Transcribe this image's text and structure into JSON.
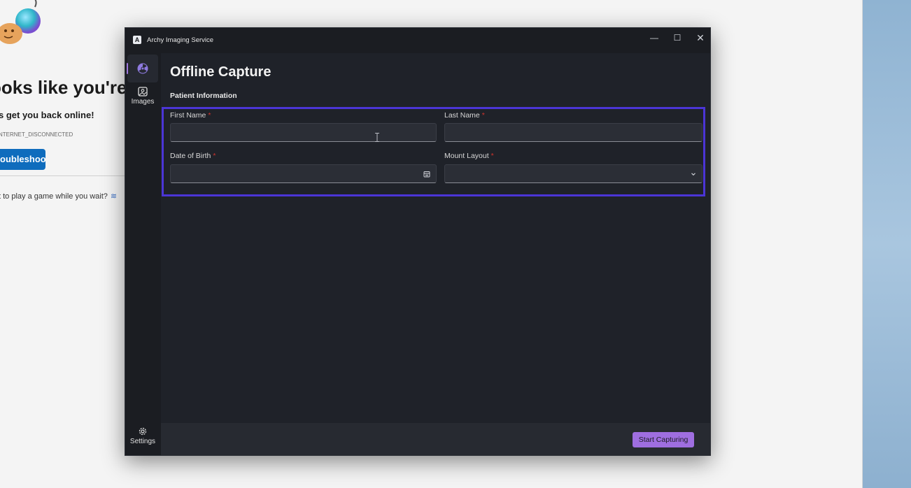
{
  "background_page": {
    "headline": "ooks like you're n",
    "subtitle": "s get you back online!",
    "error_code": "NTERNET_DISCONNECTED",
    "troubleshoot_label": "oubleshoot",
    "game_prompt": "t to play a game while you wait?",
    "game_wave": "≋"
  },
  "window": {
    "title": "Archy Imaging Service",
    "logo_letter": "A",
    "controls": {
      "minimize": "—",
      "maximize": "☐",
      "close": "✕"
    }
  },
  "sidebar": {
    "items": [
      {
        "label": "",
        "icon": "radiation-icon",
        "active": true
      },
      {
        "label": "Images",
        "icon": "image-icon"
      },
      {
        "label": "Settings",
        "icon": "gear-icon"
      }
    ]
  },
  "main": {
    "title": "Offline Capture",
    "section": "Patient Information",
    "fields": {
      "first_name": {
        "label": "First Name",
        "required": "*",
        "value": ""
      },
      "last_name": {
        "label": "Last Name",
        "required": "*",
        "value": ""
      },
      "dob": {
        "label": "Date of Birth",
        "required": "*",
        "value": "",
        "icon": "calendar-icon"
      },
      "mount_layout": {
        "label": "Mount Layout",
        "required": "*",
        "value": "",
        "icon": "chevron-down-icon"
      }
    }
  },
  "footer": {
    "start_label": "Start Capturing"
  },
  "colors": {
    "accent": "#9f6ee0",
    "highlight_border": "#4b35d6",
    "required": "#d0342c",
    "window_bg": "#1f2229"
  }
}
